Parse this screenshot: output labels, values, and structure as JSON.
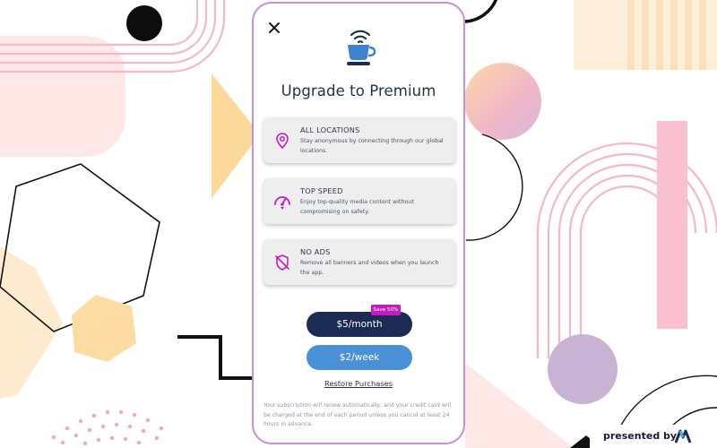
{
  "modal": {
    "close_icon": "close-icon",
    "hero_icon": "coffee-cup-wifi-icon",
    "title": "Upgrade to Premium",
    "features": [
      {
        "icon": "location-pin-icon",
        "title": "ALL LOCATIONS",
        "description": "Stay anonymous by connecting through our global locations."
      },
      {
        "icon": "speedometer-icon",
        "title": "TOP SPEED",
        "description": "Enjoy top-quality media content without compromising on safety."
      },
      {
        "icon": "shield-off-icon",
        "title": "NO ADS",
        "description": "Remove all banners and videos when you launch the app."
      }
    ],
    "plans": {
      "monthly_label": "$5/month",
      "monthly_badge": "Save 50%",
      "weekly_label": "$2/week"
    },
    "restore_label": "Restore Purchases",
    "fine_print": "Your subscription will renew automatically, and your credit card will be charged at the end of each period unless you cancel at least 24 hours in advance."
  },
  "footer": {
    "presented_by": "presented by",
    "logo_icon": "brand-logo-icon"
  },
  "colors": {
    "accent_magenta": "#c21dbf",
    "dark_navy": "#1c2b53",
    "blue": "#4a90d6",
    "title_text": "#233249",
    "phone_border": "#c58ee0"
  }
}
